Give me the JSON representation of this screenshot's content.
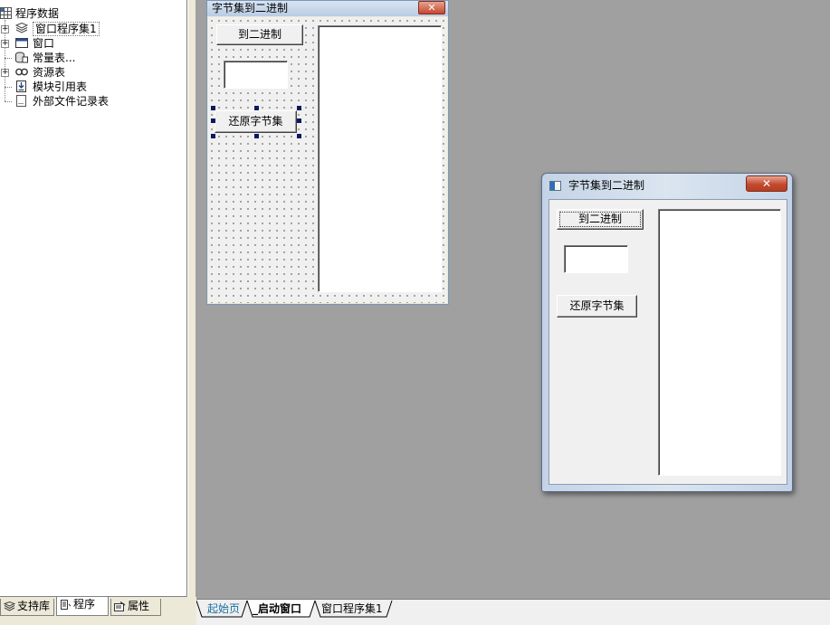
{
  "tree": {
    "root": "程序数据",
    "items": [
      {
        "label": "窗口程序集1",
        "icon": "layers-icon",
        "expandable": true
      },
      {
        "label": "窗口",
        "icon": "window-icon",
        "expandable": true
      },
      {
        "label": "常量表...",
        "icon": "database-icon",
        "expandable": false
      },
      {
        "label": "资源表",
        "icon": "resource-icon",
        "expandable": true
      },
      {
        "label": "模块引用表",
        "icon": "module-icon",
        "expandable": false
      },
      {
        "label": "外部文件记录表",
        "icon": "file-icon",
        "expandable": false
      }
    ]
  },
  "designer": {
    "title": "字节集到二进制",
    "close": "✕",
    "button_to_binary": "到二进制",
    "button_restore": "还原字节集"
  },
  "runform": {
    "title": "字节集到二进制",
    "close": "✕",
    "button_to_binary": "到二进制",
    "button_restore": "还原字节集"
  },
  "left_tabs": [
    "支持库",
    "程序",
    "属性"
  ],
  "doc_tabs": [
    "起始页",
    "_启动窗口",
    "窗口程序集1"
  ],
  "colors": {
    "workspace": "#a0a0a0",
    "doc_tab_start": "#1a6e9e",
    "selection_handles": "#0a1a60"
  }
}
